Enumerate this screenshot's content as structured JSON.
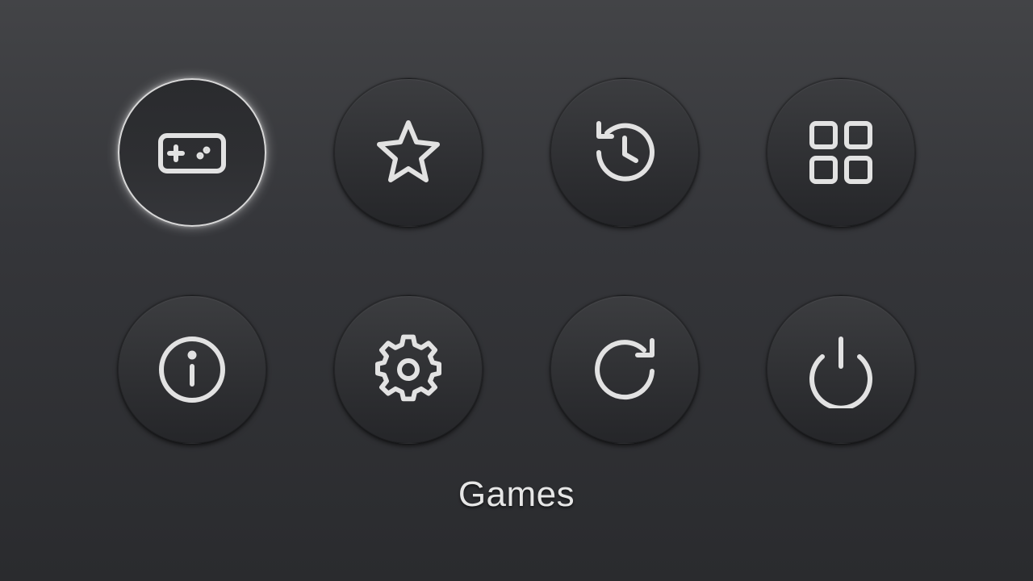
{
  "menu": {
    "selected_label": "Games",
    "items": [
      {
        "id": "games",
        "icon": "gamepad-icon",
        "selected": true
      },
      {
        "id": "favorites",
        "icon": "star-icon",
        "selected": false
      },
      {
        "id": "history",
        "icon": "history-icon",
        "selected": false
      },
      {
        "id": "apps",
        "icon": "grid-icon",
        "selected": false
      },
      {
        "id": "info",
        "icon": "info-icon",
        "selected": false
      },
      {
        "id": "settings",
        "icon": "gear-icon",
        "selected": false
      },
      {
        "id": "restart",
        "icon": "refresh-icon",
        "selected": false
      },
      {
        "id": "power",
        "icon": "power-icon",
        "selected": false
      }
    ]
  },
  "colors": {
    "icon_stroke": "#e2e2e2",
    "selected_border": "#d8d8d8",
    "background_top": "#434447",
    "background_bottom": "#2a2b2e"
  }
}
